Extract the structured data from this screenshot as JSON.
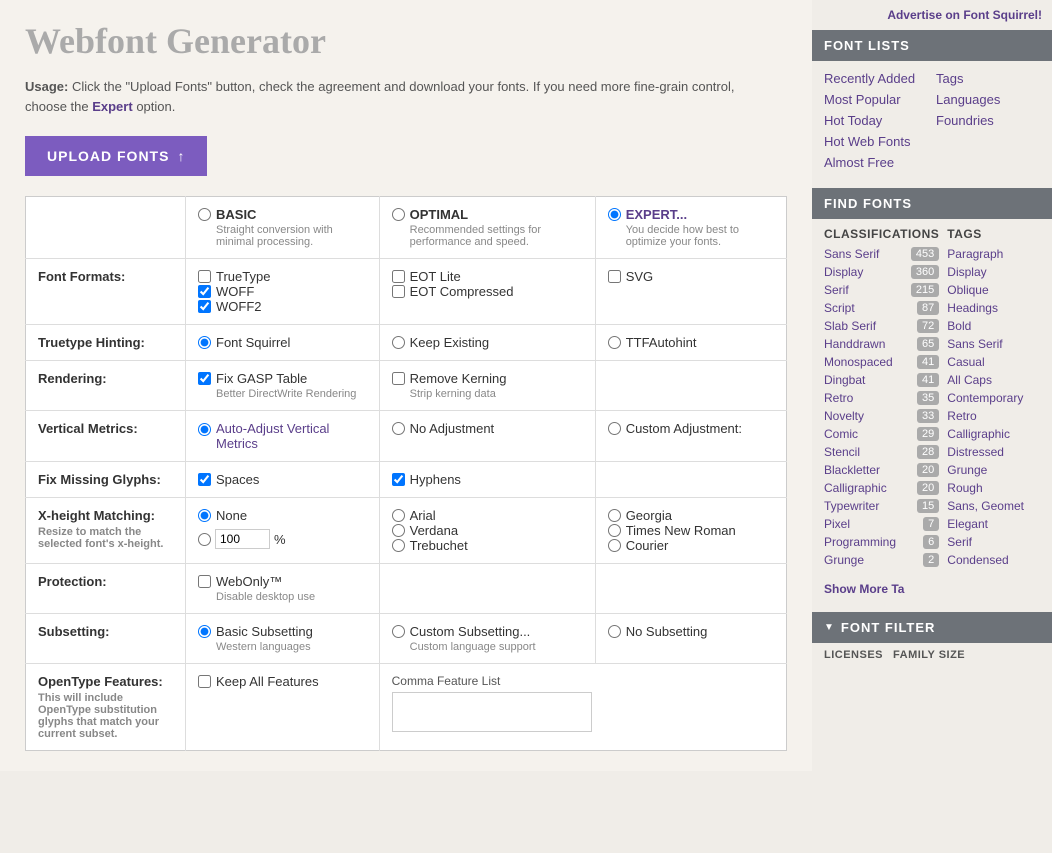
{
  "advertise": {
    "text": "Advertise on Font Squirrel!"
  },
  "page": {
    "title": "Webfont Generator",
    "usage_prefix": "Usage:",
    "usage_text": " Click the \"Upload Fonts\" button, check the agreement and download your fonts. If you need more fine-grain control, choose the ",
    "usage_expert": "Expert",
    "usage_suffix": " option.",
    "upload_button": "UPLOAD FONTS"
  },
  "modes": [
    {
      "id": "basic",
      "label": "BASIC",
      "desc": "Straight conversion with minimal processing.",
      "selected": false
    },
    {
      "id": "optimal",
      "label": "OPTIMAL",
      "desc": "Recommended settings for performance and speed.",
      "selected": false
    },
    {
      "id": "expert",
      "label": "EXPERT...",
      "desc": "You decide how best to optimize your fonts.",
      "selected": true
    }
  ],
  "settings": [
    {
      "label": "Font Formats:",
      "type": "checkboxes",
      "cols": [
        [
          {
            "label": "TrueType",
            "checked": false
          },
          {
            "label": "WOFF",
            "checked": true
          },
          {
            "label": "WOFF2",
            "checked": true
          }
        ],
        [
          {
            "label": "EOT Lite",
            "checked": false
          },
          {
            "label": "EOT Compressed",
            "checked": false
          }
        ],
        [
          {
            "label": "SVG",
            "checked": false
          }
        ]
      ]
    },
    {
      "label": "Truetype Hinting:",
      "type": "radios",
      "cols": [
        [
          {
            "label": "Font Squirrel",
            "selected": true
          }
        ],
        [
          {
            "label": "Keep Existing",
            "selected": false
          }
        ],
        [
          {
            "label": "TTFAutohint",
            "selected": false
          }
        ]
      ]
    },
    {
      "label": "Rendering:",
      "type": "mixed",
      "col1": [
        {
          "type": "checkbox",
          "label": "Fix GASP Table",
          "checked": true
        },
        {
          "sublabel": "Better DirectWrite Rendering"
        }
      ],
      "col2": [
        {
          "type": "checkbox",
          "label": "Remove Kerning",
          "checked": false
        },
        {
          "sublabel": "Strip kerning data"
        }
      ]
    },
    {
      "label": "Vertical Metrics:",
      "type": "radios3",
      "col1": {
        "label": "Auto-Adjust Vertical Metrics",
        "selected": true
      },
      "col2": {
        "label": "No Adjustment",
        "selected": false
      },
      "col3": {
        "label": "Custom Adjustment:",
        "selected": false
      }
    },
    {
      "label": "Fix Missing Glyphs:",
      "type": "checkboxes_inline",
      "items": [
        {
          "label": "Spaces",
          "checked": true
        },
        {
          "label": "Hyphens",
          "checked": true
        }
      ]
    },
    {
      "label": "X-height Matching:",
      "sublabel": "Resize to match the selected font's x-height.",
      "type": "xheight",
      "col1_radios": [
        {
          "label": "None",
          "selected": true
        }
      ],
      "col2_radios": [
        {
          "label": "Arial",
          "selected": false
        },
        {
          "label": "Verdana",
          "selected": false
        },
        {
          "label": "Trebuchet",
          "selected": false
        }
      ],
      "col3_radios": [
        {
          "label": "Georgia",
          "selected": false
        },
        {
          "label": "Times New Roman",
          "selected": false
        },
        {
          "label": "Courier",
          "selected": false
        }
      ],
      "percent_value": "100"
    },
    {
      "label": "Protection:",
      "type": "protection",
      "item": {
        "label": "WebOnly™",
        "checked": false
      },
      "sublabel": "Disable desktop use"
    },
    {
      "label": "Subsetting:",
      "type": "radios3",
      "col1": {
        "label": "Basic Subsetting",
        "selected": true,
        "sublabel": "Western languages"
      },
      "col2": {
        "label": "Custom Subsetting...",
        "selected": false,
        "sublabel": "Custom language support"
      },
      "col3": {
        "label": "No Subsetting",
        "selected": false
      }
    },
    {
      "label": "OpenType Features:",
      "sublabel": "This will include OpenType substitution glyphs that match your current subset.",
      "type": "opentype",
      "item": {
        "label": "Keep All Features",
        "checked": false
      },
      "input_placeholder": "Comma Feature List"
    }
  ],
  "sidebar": {
    "font_lists_header": "FONT LISTS",
    "font_lists": [
      {
        "label": "Recently Added",
        "col": 1
      },
      {
        "label": "Tags",
        "col": 2
      },
      {
        "label": "Most Popular",
        "col": 1
      },
      {
        "label": "Languages",
        "col": 2
      },
      {
        "label": "Hot Today",
        "col": 1
      },
      {
        "label": "Foundries",
        "col": 2
      },
      {
        "label": "Hot Web Fonts",
        "col": 1
      },
      {
        "label": "Almost Free",
        "col": 1
      }
    ],
    "find_fonts_header": "FIND FONTS",
    "classifications_header": "CLASSIFICATIONS",
    "tags_header": "TAGS",
    "classifications": [
      {
        "label": "Sans Serif",
        "count": "453"
      },
      {
        "label": "Display",
        "count": "360"
      },
      {
        "label": "Serif",
        "count": "215"
      },
      {
        "label": "Script",
        "count": "87"
      },
      {
        "label": "Slab Serif",
        "count": "72"
      },
      {
        "label": "Handdrawn",
        "count": "65"
      },
      {
        "label": "Monospaced",
        "count": "41"
      },
      {
        "label": "Dingbat",
        "count": "41"
      },
      {
        "label": "Retro",
        "count": "35"
      },
      {
        "label": "Novelty",
        "count": "33"
      },
      {
        "label": "Comic",
        "count": "29"
      },
      {
        "label": "Stencil",
        "count": "28"
      },
      {
        "label": "Blackletter",
        "count": "20"
      },
      {
        "label": "Calligraphic",
        "count": "20"
      },
      {
        "label": "Typewriter",
        "count": "15"
      },
      {
        "label": "Pixel",
        "count": "7"
      },
      {
        "label": "Programming",
        "count": "6"
      },
      {
        "label": "Grunge",
        "count": "2"
      }
    ],
    "tags": [
      {
        "label": "Paragraph"
      },
      {
        "label": "Display"
      },
      {
        "label": "Oblique"
      },
      {
        "label": "Headings"
      },
      {
        "label": "Bold"
      },
      {
        "label": "Sans Serif"
      },
      {
        "label": "Casual"
      },
      {
        "label": "All Caps"
      },
      {
        "label": "Contemporary"
      },
      {
        "label": "Retro"
      },
      {
        "label": "Calligraphic"
      },
      {
        "label": "Distressed"
      },
      {
        "label": "Grunge"
      },
      {
        "label": "Rough"
      },
      {
        "label": "Sans, Geomet"
      },
      {
        "label": "Elegant"
      },
      {
        "label": "Serif"
      },
      {
        "label": "Condensed"
      }
    ],
    "show_more": "Show More Ta",
    "font_filter_header": "FONT FILTER",
    "filter_subheaders": [
      "LICENSES",
      "FAMILY SIZE"
    ]
  }
}
